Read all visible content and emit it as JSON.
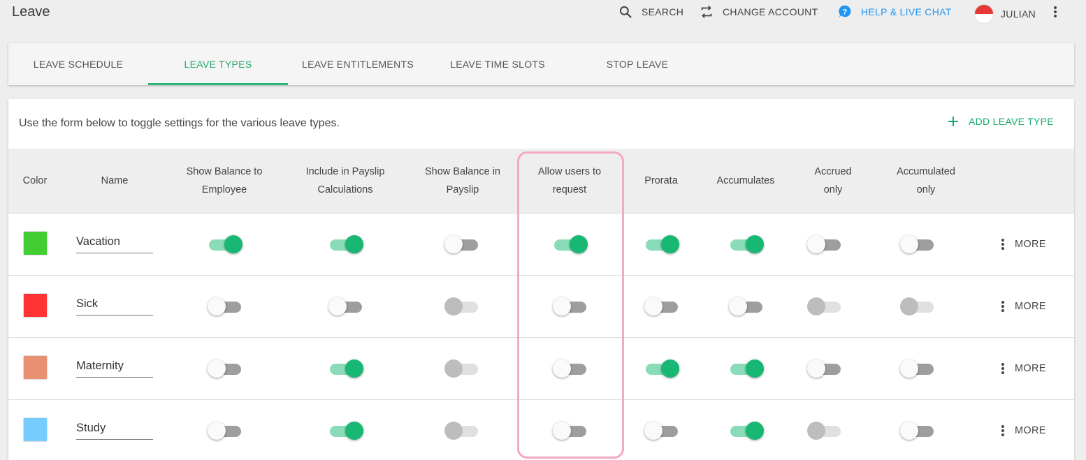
{
  "app": {
    "title": "Leave"
  },
  "topbar": {
    "search": "SEARCH",
    "change_account": "CHANGE ACCOUNT",
    "help": "HELP & LIVE CHAT",
    "user": "JULIAN",
    "icons": [
      "search-icon",
      "swap-icon",
      "help-icon",
      "avatar",
      "more-vert-icon"
    ]
  },
  "tabs": [
    {
      "label": "LEAVE SCHEDULE",
      "active": false
    },
    {
      "label": "LEAVE TYPES",
      "active": true
    },
    {
      "label": "LEAVE ENTITLEMENTS",
      "active": false
    },
    {
      "label": "LEAVE TIME SLOTS",
      "active": false
    },
    {
      "label": "STOP LEAVE",
      "active": false
    }
  ],
  "card": {
    "intro": "Use the form below to toggle settings for the various leave types.",
    "add_label": "ADD LEAVE TYPE"
  },
  "columns": [
    "Color",
    "Name",
    "Show Balance to Employee",
    "Include in Payslip Calculations",
    "Show Balance in Payslip",
    "Allow users to request",
    "Prorata",
    "Accumulates",
    "Accrued only",
    "Accumulated only"
  ],
  "more_label": "MORE",
  "rows": [
    {
      "name": "Vacation",
      "color": "#44cc33",
      "toggles": [
        "on",
        "on",
        "off",
        "on",
        "on",
        "on",
        "off",
        "off"
      ]
    },
    {
      "name": "Sick",
      "color": "#ff3333",
      "toggles": [
        "off",
        "off",
        "dis",
        "off",
        "off",
        "off",
        "dis",
        "dis"
      ]
    },
    {
      "name": "Maternity",
      "color": "#e89070",
      "toggles": [
        "off",
        "on",
        "dis",
        "off",
        "on",
        "on",
        "off",
        "off"
      ]
    },
    {
      "name": "Study",
      "color": "#77ccff",
      "toggles": [
        "off",
        "on",
        "dis",
        "off",
        "off",
        "on",
        "dis",
        "off"
      ]
    }
  ],
  "colors": {
    "accent": "#18b874",
    "help": "#2196f3",
    "highlight": "#f4a9c4"
  }
}
